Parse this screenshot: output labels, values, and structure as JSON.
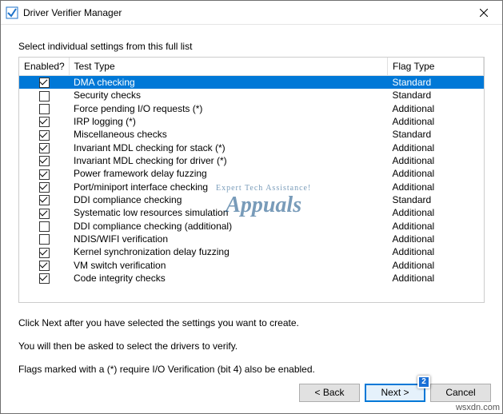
{
  "window": {
    "title": "Driver Verifier Manager"
  },
  "instruction": "Select individual settings from this full list",
  "columns": {
    "enabled": "Enabled?",
    "testtype": "Test Type",
    "flagtype": "Flag Type"
  },
  "rows": [
    {
      "checked": true,
      "selected": true,
      "test": "DMA checking",
      "flag": "Standard"
    },
    {
      "checked": false,
      "selected": false,
      "test": "Security checks",
      "flag": "Standard"
    },
    {
      "checked": false,
      "selected": false,
      "test": "Force pending I/O requests (*)",
      "flag": "Additional"
    },
    {
      "checked": true,
      "selected": false,
      "test": "IRP logging (*)",
      "flag": "Additional"
    },
    {
      "checked": true,
      "selected": false,
      "test": "Miscellaneous checks",
      "flag": "Standard"
    },
    {
      "checked": true,
      "selected": false,
      "test": "Invariant MDL checking for stack (*)",
      "flag": "Additional"
    },
    {
      "checked": true,
      "selected": false,
      "test": "Invariant MDL checking for driver (*)",
      "flag": "Additional"
    },
    {
      "checked": true,
      "selected": false,
      "test": "Power framework delay fuzzing",
      "flag": "Additional"
    },
    {
      "checked": true,
      "selected": false,
      "test": "Port/miniport interface checking",
      "flag": "Additional"
    },
    {
      "checked": true,
      "selected": false,
      "test": "DDI compliance checking",
      "flag": "Standard"
    },
    {
      "checked": true,
      "selected": false,
      "test": "Systematic low resources simulation",
      "flag": "Additional"
    },
    {
      "checked": false,
      "selected": false,
      "test": "DDI compliance checking (additional)",
      "flag": "Additional"
    },
    {
      "checked": false,
      "selected": false,
      "test": "NDIS/WIFI verification",
      "flag": "Additional"
    },
    {
      "checked": true,
      "selected": false,
      "test": "Kernel synchronization delay fuzzing",
      "flag": "Additional"
    },
    {
      "checked": true,
      "selected": false,
      "test": "VM switch verification",
      "flag": "Additional"
    },
    {
      "checked": true,
      "selected": false,
      "test": "Code integrity checks",
      "flag": "Additional"
    }
  ],
  "notes": {
    "line1": "Click Next after you have selected the settings you want to create.",
    "line2": "You will then be asked to select the drivers to verify.",
    "line3": "Flags marked with a (*) require I/O Verification (bit 4) also be enabled."
  },
  "buttons": {
    "back": "< Back",
    "next": "Next >",
    "cancel": "Cancel"
  },
  "badge": "2",
  "watermark": {
    "small": "Expert Tech Assistance!",
    "large": "Appuals"
  },
  "footer_credit": "wsxdn.com"
}
